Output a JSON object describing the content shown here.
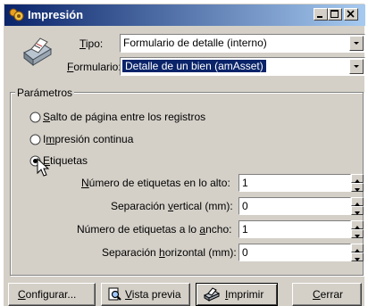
{
  "window": {
    "title": "Impresión"
  },
  "fields": {
    "tipo_label_u": "T",
    "tipo_label_rest": "ipo:",
    "tipo_value": "Formulario de detalle (interno)",
    "formulario_label_u": "F",
    "formulario_label_rest": "ormulario:",
    "formulario_value": "Detalle de un bien (amAsset)"
  },
  "parametros": {
    "title": "Parámetros",
    "radios": [
      {
        "u": "S",
        "rest": "alto de página entre los registros",
        "selected": false
      },
      {
        "pre": "I",
        "u": "m",
        "rest": "presión continua",
        "selected": false
      },
      {
        "u": "E",
        "rest": "tiquetas",
        "selected": true
      }
    ],
    "spinners": [
      {
        "pre": "",
        "u": "N",
        "rest": "úmero de etiquetas en lo alto:",
        "value": "1"
      },
      {
        "pre": "Separación ",
        "u": "v",
        "rest": "ertical (mm):",
        "value": "0"
      },
      {
        "pre": "Número de etiquetas a lo ",
        "u": "a",
        "rest": "ncho:",
        "value": "1"
      },
      {
        "pre": "Separación ",
        "u": "h",
        "rest": "orizontal (mm):",
        "value": "0"
      }
    ]
  },
  "buttons": {
    "configurar": {
      "u": "C",
      "rest": "onfigurar..."
    },
    "vista_previa": {
      "u": "V",
      "rest": "ista previa"
    },
    "imprimir": {
      "u": "I",
      "rest": "mprimir"
    },
    "cerrar": {
      "u": "C",
      "rest": "errar"
    }
  },
  "colors": {
    "titlebar_start": "#0a246a",
    "titlebar_end": "#a6caf0",
    "face": "#d4d0c8",
    "selection": "#0a246a"
  }
}
